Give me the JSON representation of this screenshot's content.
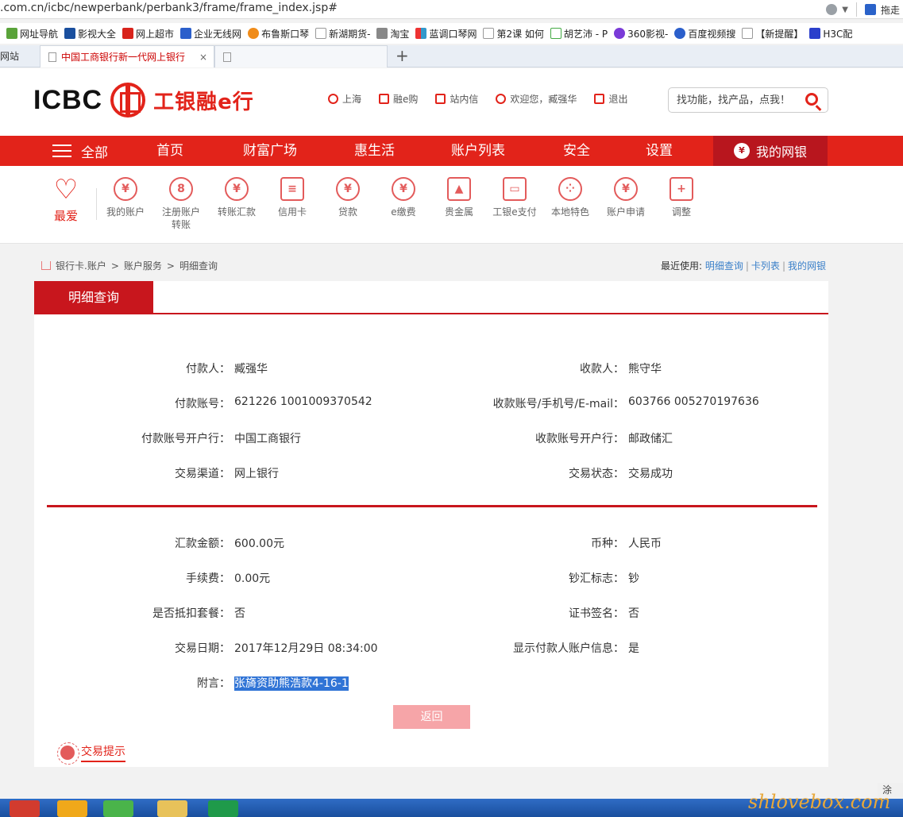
{
  "browser": {
    "url": ".com.cn/icbc/newperbank/perbank3/frame/frame_index.jsp#",
    "right_hint": "拖走",
    "bookmarks": [
      "网址导航",
      "影视大全",
      "网上超市",
      "企业无线网",
      "布鲁斯口琴",
      "新湖期货-",
      "淘宝",
      "蓝调口琴网",
      "第2课 如何",
      "胡艺沛 - P",
      "360影视-",
      "百度视频搜",
      "【新提醒】",
      "H3C配"
    ],
    "left_tab_fragment": "网站",
    "active_tab": "中国工商银行新一代网上银行",
    "tab_close": "×",
    "new_tab": "+"
  },
  "header": {
    "brand": "ICBC",
    "slogan": "工银融e行",
    "links": {
      "location": "上海",
      "mall": "融e购",
      "messages": "站内信",
      "welcome": "欢迎您，臧强华",
      "logout": "退出"
    },
    "search_placeholder": "找功能，找产品，点我！"
  },
  "nav": {
    "all": "全部",
    "items": [
      "首页",
      "财富广场",
      "惠生活",
      "账户列表",
      "安全",
      "设置"
    ],
    "my_bank": "我的网银",
    "my_bank_badge": "¥"
  },
  "shortcuts": {
    "favorites": "最爱",
    "items": [
      {
        "label": "我的账户",
        "glyph": "¥"
      },
      {
        "label": "注册账户\n转账",
        "glyph": "8"
      },
      {
        "label": "转账汇款",
        "glyph": "¥"
      },
      {
        "label": "信用卡",
        "glyph": "≡"
      },
      {
        "label": "贷款",
        "glyph": "¥"
      },
      {
        "label": "e缴费",
        "glyph": "¥"
      },
      {
        "label": "贵金属",
        "glyph": "▲"
      },
      {
        "label": "工银e支付",
        "glyph": "▭"
      },
      {
        "label": "本地特色",
        "glyph": "⁘"
      },
      {
        "label": "账户申请",
        "glyph": "¥"
      },
      {
        "label": "调整",
        "glyph": "+"
      }
    ]
  },
  "breadcrumb": {
    "items": [
      "银行卡.账户",
      "账户服务",
      "明细查询"
    ],
    "sep": ">"
  },
  "recent": {
    "label": "最近使用:",
    "links": [
      "明细查询",
      "卡列表",
      "我的网银"
    ],
    "sep": "|"
  },
  "detail": {
    "tab": "明细查询",
    "payer_label": "付款人：",
    "payer": "臧强华",
    "payee_label": "收款人：",
    "payee": "熊守华",
    "payer_account_label": "付款账号：",
    "payer_account": "621226 1001009370542",
    "payee_account_label": "收款账号/手机号/E-mail：",
    "payee_account": "603766 005270197636",
    "payer_bank_label": "付款账号开户行：",
    "payer_bank": "中国工商银行",
    "payee_bank_label": "收款账号开户行：",
    "payee_bank": "邮政储汇",
    "channel_label": "交易渠道：",
    "channel": "网上银行",
    "status_label": "交易状态：",
    "status": "交易成功",
    "amount_label": "汇款金额：",
    "amount": "600.00元",
    "currency_label": "币种：",
    "currency": "人民币",
    "fee_label": "手续费：",
    "fee": "0.00元",
    "cash_flag_label": "钞汇标志：",
    "cash_flag": "钞",
    "package_label": "是否抵扣套餐：",
    "package": "否",
    "cert_label": "证书签名：",
    "cert": "否",
    "date_label": "交易日期：",
    "date": "2017年12月29日 08:34:00",
    "show_payer_label": "显示付款人账户信息：",
    "show_payer": "是",
    "note_label": "附言：",
    "note": "张旖资助熊浩款4-16-1",
    "back_button": "返回"
  },
  "tips": {
    "title": "交易提示"
  },
  "taskbar": {
    "watermark": "shlovebox.com",
    "sys": "涂"
  },
  "colors": {
    "brand_red": "#e2231a",
    "dark_red": "#c8161d",
    "link_blue": "#3b80c9",
    "button_pink": "#f6a5a8"
  }
}
